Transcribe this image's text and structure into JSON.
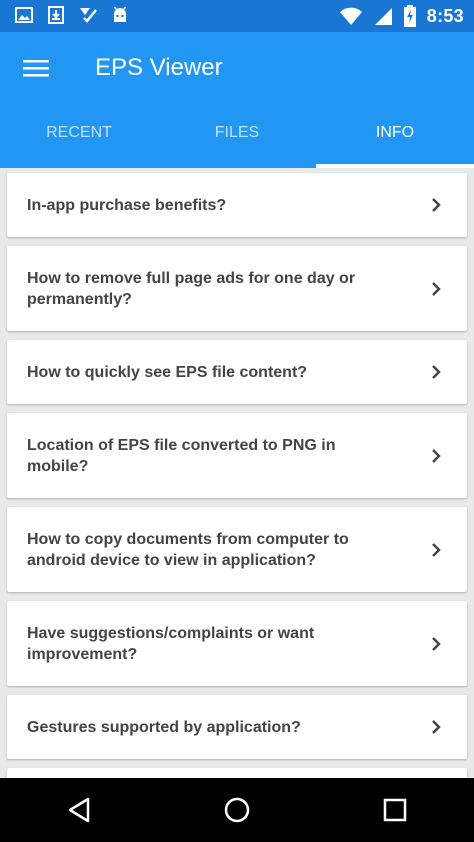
{
  "status_bar": {
    "time": "8:53",
    "left_icons": [
      "gallery-icon",
      "download-icon",
      "tasks-icon",
      "android-icon"
    ],
    "right_icons": [
      "wifi-icon",
      "signal-icon",
      "battery-charging-icon"
    ]
  },
  "app_bar": {
    "title": "EPS Viewer",
    "menu_icon": "hamburger-menu-icon"
  },
  "tabs": [
    {
      "label": "RECENT",
      "active": false
    },
    {
      "label": "FILES",
      "active": false
    },
    {
      "label": "INFO",
      "active": true
    }
  ],
  "info_items": [
    {
      "label": "In-app purchase benefits?"
    },
    {
      "label": "How to remove full page ads for one day or permanently?"
    },
    {
      "label": "How to quickly see EPS file content?"
    },
    {
      "label": "Location of EPS file converted to PNG in mobile?"
    },
    {
      "label": "How to copy documents from computer to android device to view in application?"
    },
    {
      "label": "Have suggestions/complaints or want improvement?"
    },
    {
      "label": "Gestures supported by application?"
    }
  ],
  "nav_bar": {
    "icons": [
      "back-icon",
      "home-icon",
      "recents-icon"
    ]
  },
  "colors": {
    "primary": "#2196f3",
    "primary_dark": "#1976d2",
    "card_text": "#444444",
    "background": "#e9e9e9"
  }
}
